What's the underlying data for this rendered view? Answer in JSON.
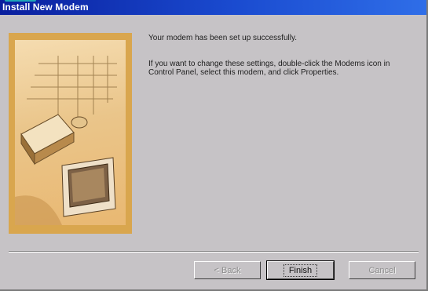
{
  "window": {
    "title": "Install New Modem"
  },
  "content": {
    "message_success": "Your modem has been set up successfully.",
    "message_instructions": "If you want to change these settings, double-click the Modems icon in Control Panel, select this modem, and click Properties."
  },
  "buttons": {
    "back": "< Back",
    "finish": "Finish",
    "cancel": "Cancel"
  },
  "colors": {
    "titlebar_start": "#0a1f9e",
    "titlebar_end": "#2f6ee8",
    "dialog_face": "#c6c3c6",
    "art_frame": "#d9a64e"
  }
}
